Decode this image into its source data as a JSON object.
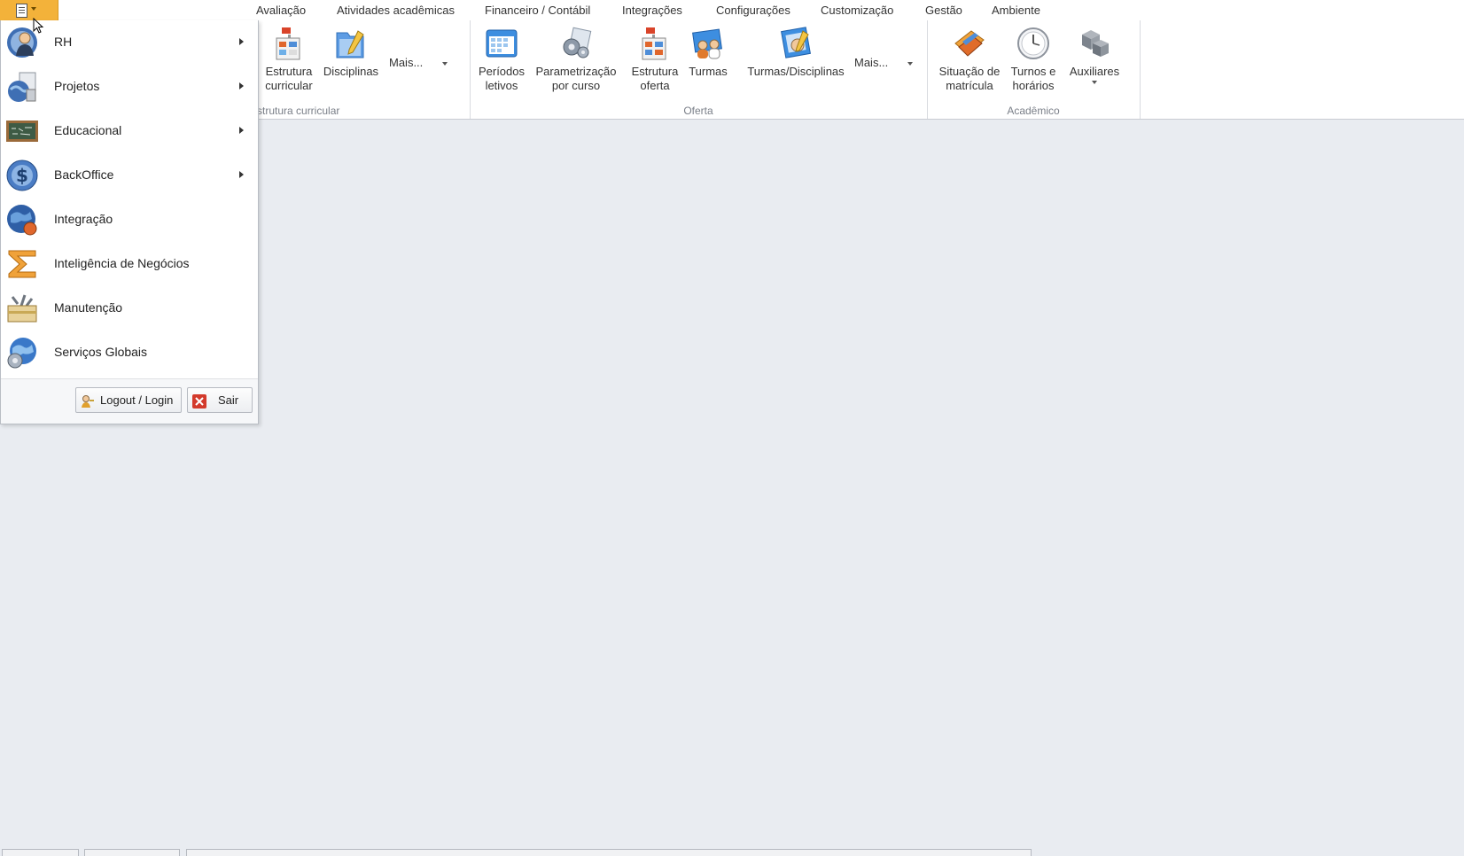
{
  "tabs": [
    "Avaliação",
    "Atividades acadêmicas",
    "Financeiro / Contábil",
    "Integrações",
    "Configurações",
    "Customização",
    "Gestão",
    "Ambiente"
  ],
  "ribbon": {
    "groups": [
      {
        "label": "strutura curricular",
        "buttons": [
          "Estrutura\ncurricular",
          "Disciplinas"
        ],
        "more": "Mais..."
      },
      {
        "label": "Oferta",
        "buttons": [
          "Períodos\nletivos",
          "Parametrização\npor curso",
          "Estrutura\noferta",
          "Turmas",
          "Turmas/Disciplinas"
        ],
        "more": "Mais..."
      },
      {
        "label": "Acadêmico",
        "buttons": [
          "Situação de\nmatrícula",
          "Turnos e\nhorários",
          "Auxiliares"
        ]
      }
    ]
  },
  "app_menu": {
    "items": [
      {
        "label": "RH",
        "icon": "hr-person-icon",
        "submenu": true
      },
      {
        "label": "Projetos",
        "icon": "projects-icon",
        "submenu": true
      },
      {
        "label": "Educacional",
        "icon": "chalkboard-icon",
        "submenu": true
      },
      {
        "label": "BackOffice",
        "icon": "dollar-coin-icon",
        "submenu": true
      },
      {
        "label": "Integração",
        "icon": "globe-integration-icon",
        "submenu": false
      },
      {
        "label": "Inteligência de Negócios",
        "icon": "sigma-icon",
        "submenu": false
      },
      {
        "label": "Manutenção",
        "icon": "toolbox-icon",
        "submenu": false
      },
      {
        "label": "Serviços Globais",
        "icon": "globe-gear-icon",
        "submenu": false
      }
    ],
    "logout_label": "Logout / Login",
    "exit_label": "Sair"
  },
  "colors": {
    "accent": "#f3b23a",
    "background": "#e9ecf1",
    "ribbon": "#ffffff",
    "group_label": "#7a7f88"
  }
}
